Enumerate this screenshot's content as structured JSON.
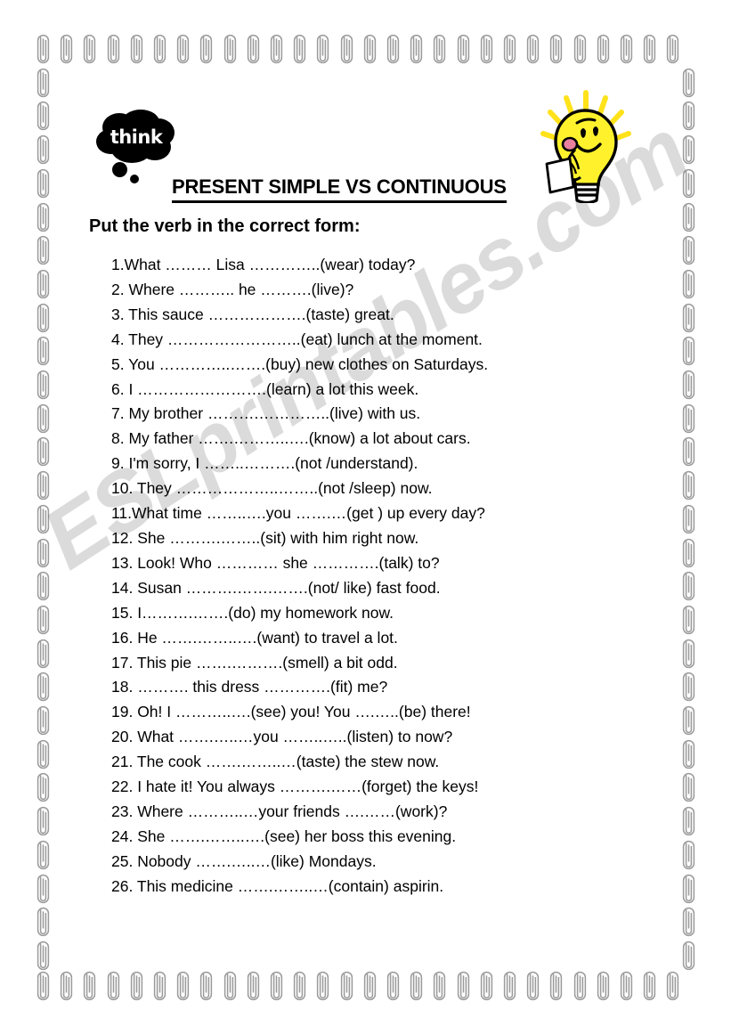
{
  "document": {
    "title": "PRESENT SIMPLE VS CONTINUOUS",
    "instruction": "Put the verb in the correct form:",
    "think_label": "think",
    "watermark": "ESLprintables.com"
  },
  "icons": {
    "think_bubble": "thought-cloud-icon",
    "light_bulb": "smiling-lightbulb-character-icon",
    "paperclip": "paperclip-icon"
  },
  "colors": {
    "bulb_yellow": "#FFF22D",
    "bulb_outline": "#000000",
    "bulb_tongue": "#E8809F",
    "paperclip_gray": "#9a9a9a",
    "text_black": "#000000",
    "watermark_gray": "#d5d5d5"
  },
  "exercises": [
    "1.What ………  Lisa …………..(wear) today?",
    "2. Where ……….. he ……….(live)?",
    "3. This sauce ……………….(taste) great.",
    "4. They ……………………..(eat) lunch at the moment.",
    "5. You  …………..…….(buy) new clothes on Saturdays.",
    "6. I …………………….(learn) a lot this week.",
    "7. My brother ……….…………..(live) with us.",
    "8. My father …….………..….(know) a lot about cars.",
    "9. I'm sorry, I ……..……….(not /understand).",
    "10. They ………………..……..(not /sleep) now.",
    "11.What time ……..….you …….…(get ) up every day?",
    "12. She ……….……..(sit) with him right now.",
    "13. Look! Who ………… she ………….(talk) to?",
    "14. Susan ……….…….…….(not/ like) fast food.",
    "15. I……….…….(do) my homework now.",
    "16. He …….……..….(want) to travel a lot.",
    "17. This pie …….……….(smell) a bit odd.",
    "18. ………. this dress ………….(fit) me?",
    "19. Oh! I ………..….(see) you! You ….…..(be) there!",
    "20. What …….…..…you ……..…..(listen) to now?",
    "21. The cook …….……..…(taste) the stew now.",
    "22. I hate it! You always ……….……(forget) the keys!",
    "23. Where ………..…your friends ….……(work)?",
    "24. She …….……..….(see) her boss this evening.",
    "25. Nobody …….…..…(like) Mondays.",
    "26. This medicine …….……..…(contain) aspirin."
  ]
}
